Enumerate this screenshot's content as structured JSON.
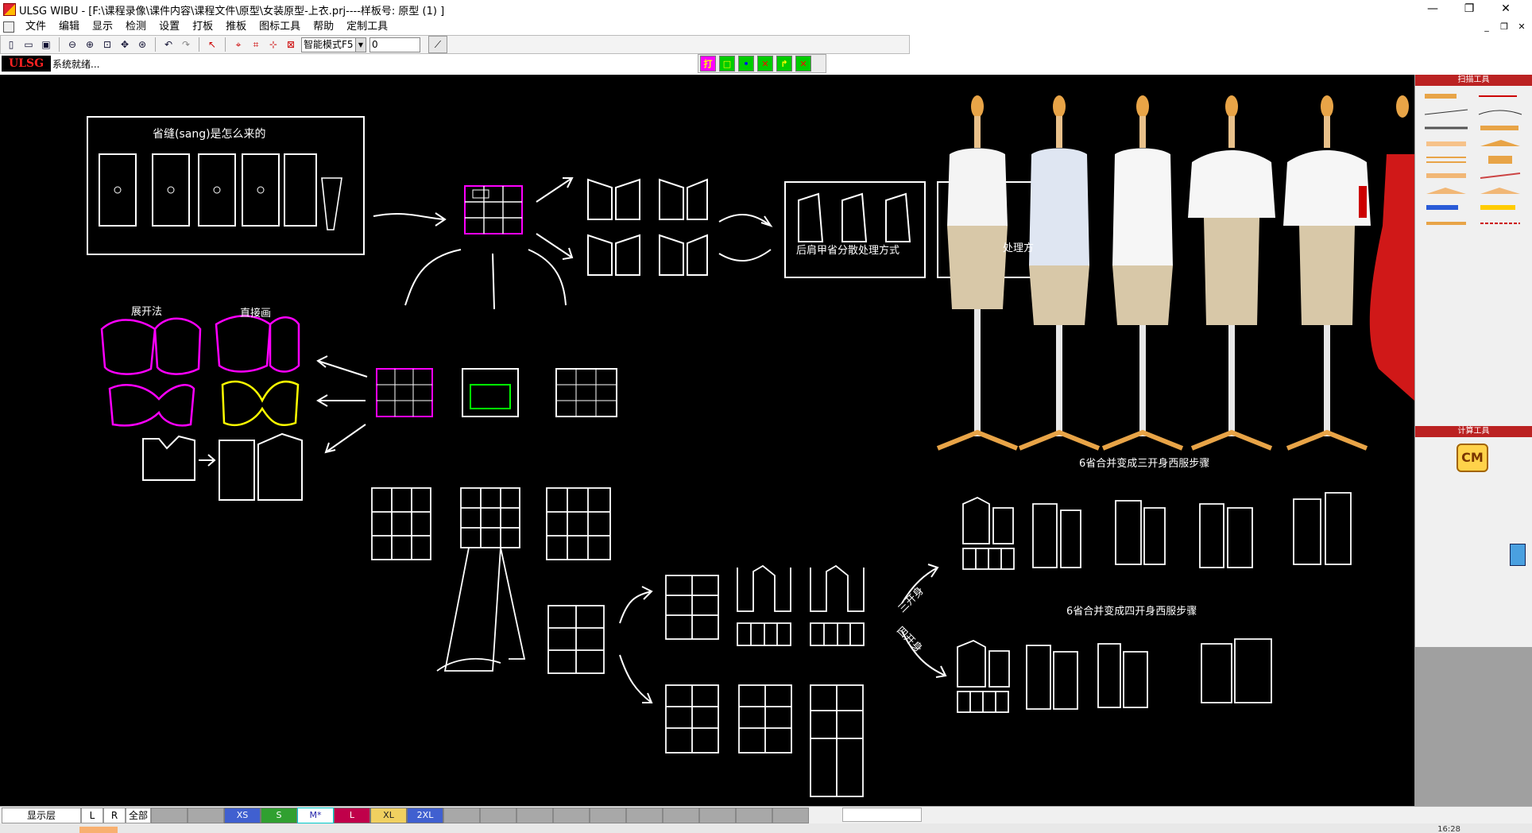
{
  "window": {
    "title": "ULSG WIBU - [F:\\课程录像\\课件内容\\课程文件\\原型\\女装原型-上衣.prj----样板号: 原型  (1) ]",
    "controls": [
      "—",
      "❐",
      "✕"
    ],
    "mdi_controls": [
      "_",
      "❐",
      "✕"
    ]
  },
  "menu": [
    "文件",
    "编辑",
    "显示",
    "检测",
    "设置",
    "打板",
    "推板",
    "图标工具",
    "帮助",
    "定制工具"
  ],
  "toolbar": {
    "mode_select": "智能模式F5",
    "value_input": "0"
  },
  "status": {
    "logo": "ULSG",
    "text": "系统就绪..."
  },
  "mode_bar": {
    "buttons": [
      {
        "label": "打",
        "color": "#ff00ff"
      },
      {
        "label": "□",
        "color": "#ffff00"
      },
      {
        "label": "•",
        "color": "#00ff00"
      },
      {
        "label": "✕",
        "color": "#00cc00"
      },
      {
        "label": "↱",
        "color": "#00cc00"
      },
      {
        "label": "✕",
        "color": "#00cc00"
      }
    ]
  },
  "canvas": {
    "texts": {
      "dart_title": "省缝(sang)是怎么来的",
      "unfold": "展开法",
      "direct": "直接画",
      "back_dart": "后肩甲省分散处理方式",
      "back_dart_partial": "处理方",
      "three_piece": "6省合并变成三开身西服步骤",
      "four_piece": "6省合并变成四开身西服步骤",
      "three_arrow": "三开身",
      "four_arrow": "四开身"
    }
  },
  "right_panel": {
    "header_top": "扫描工具",
    "header_bottom": "计算工具",
    "cm": "CM"
  },
  "bottom": {
    "layer_label": "显示层",
    "btn_l": "L",
    "btn_r": "R",
    "btn_all": "全部",
    "sizes": [
      {
        "label": "",
        "color": "#a8a8a8"
      },
      {
        "label": "",
        "color": "#a8a8a8"
      },
      {
        "label": "XS",
        "color": "#4060d0"
      },
      {
        "label": "S",
        "color": "#30a030"
      },
      {
        "label": "M*",
        "color": "#ffffff"
      },
      {
        "label": "L",
        "color": "#c0004a"
      },
      {
        "label": "XL",
        "color": "#f0d060"
      },
      {
        "label": "2XL",
        "color": "#4060d0"
      }
    ],
    "clock": "16:28"
  }
}
